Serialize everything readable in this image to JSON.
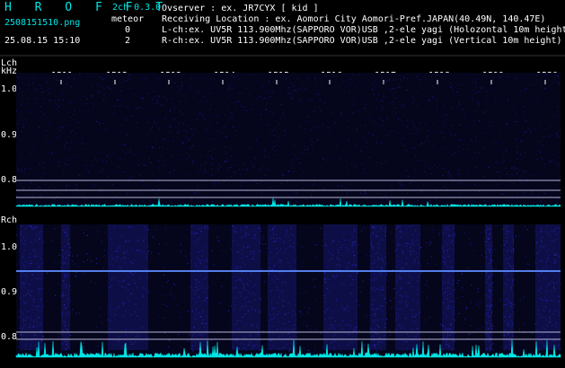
{
  "header": {
    "app_title": "H R O F F T",
    "version": "2ch 0.3.0",
    "filename": "2508151510.png",
    "meteor_label": "meteor",
    "datetime": "25.08.15 15:10",
    "meteor_l_count": "0",
    "meteor_r_count": "2",
    "observer": "Ovserver           : ex. JR7CYX [ kid ]",
    "location": "Receiving Location : ex. Aomori City Aomori-Pref.JAPAN(40.49N, 140.47E)",
    "lch_info": "L-ch:ex. UV5R 113.900Mhz(SAPPORO VOR)USB ,2-ele yagi (Holozontal 10m height)",
    "rch_info": "R-ch:ex. UV5R 113.900Mhz(SAPPORO VOR)USB ,2-ele yagi (Vertical 10m height)"
  },
  "time_ticks": [
    "1511",
    "1512",
    "1513",
    "1514",
    "1515",
    "1516",
    "1517",
    "1518",
    "1519",
    "1520"
  ],
  "lch_panel": {
    "title": "Lch",
    "unit": "kHz",
    "freq_labels": [
      "1.0",
      "0.9",
      "0.8"
    ]
  },
  "rch_panel": {
    "title": "Rch",
    "freq_labels": [
      "1.0",
      "0.9",
      "0.8"
    ]
  },
  "colors": {
    "text_cyan": "#00e5e5",
    "text_white": "#ffffff",
    "background": "#000000",
    "spectrogram_base": "#05051c",
    "spectrogram_noise": "#2a2ad0",
    "carrier_line": "#5a8cff",
    "power_trace": "#00e5e5"
  }
}
